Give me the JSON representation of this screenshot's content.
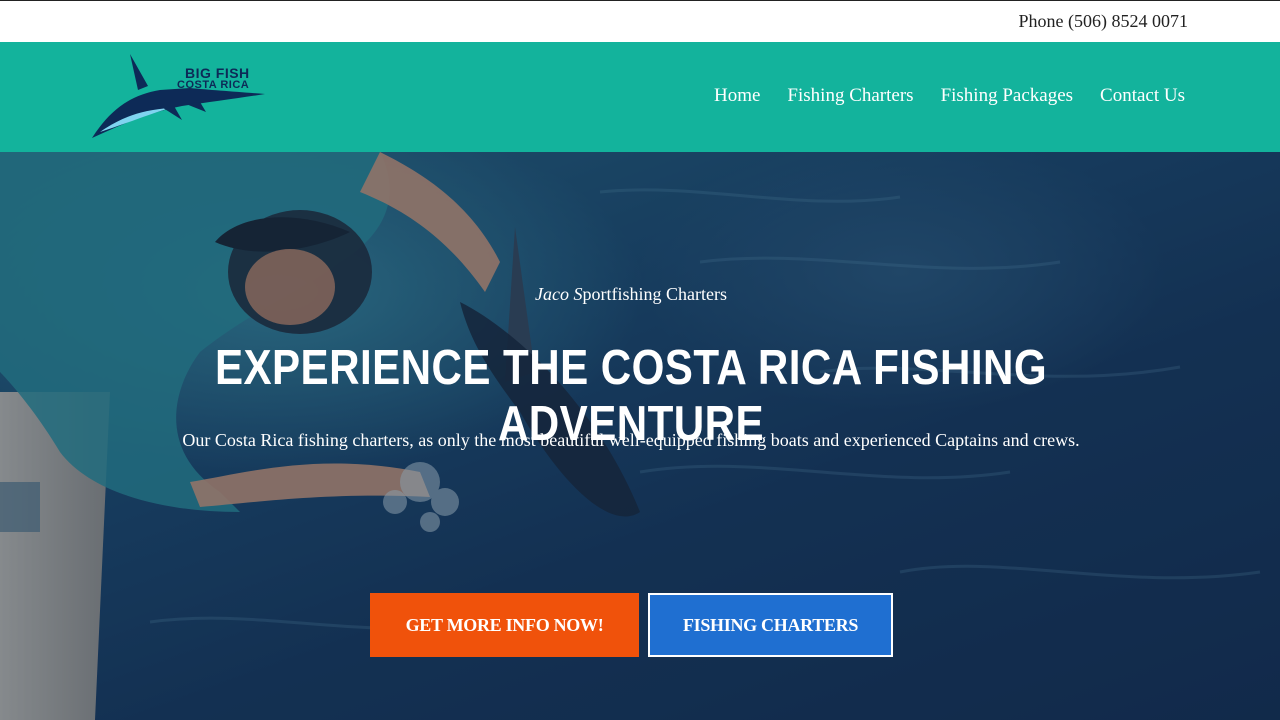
{
  "topbar": {
    "phone": "Phone (506) 8524 0071"
  },
  "logo": {
    "line1": "BIG FISH",
    "line2": "COSTA RICA",
    "icon": "marlin-icon"
  },
  "nav": {
    "items": [
      {
        "label": "Home"
      },
      {
        "label": "Fishing Charters"
      },
      {
        "label": "Fishing Packages"
      },
      {
        "label": "Contact Us"
      }
    ]
  },
  "hero": {
    "tagline_italic": "Jaco S",
    "tagline_rest": "portfishing Charters",
    "headline": "EXPERIENCE THE COSTA RICA FISHING ADVENTURE",
    "subtext": "Our Costa Rica fishing charters, as only the most beautiful well-equipped fishing boats and experienced Captains and crews.",
    "primary_button": "GET MORE INFO NOW!",
    "secondary_button": "FISHING CHARTERS"
  },
  "colors": {
    "header": "#13b39c",
    "primary_button": "#f0520b",
    "secondary_button": "#1f6fd1"
  }
}
